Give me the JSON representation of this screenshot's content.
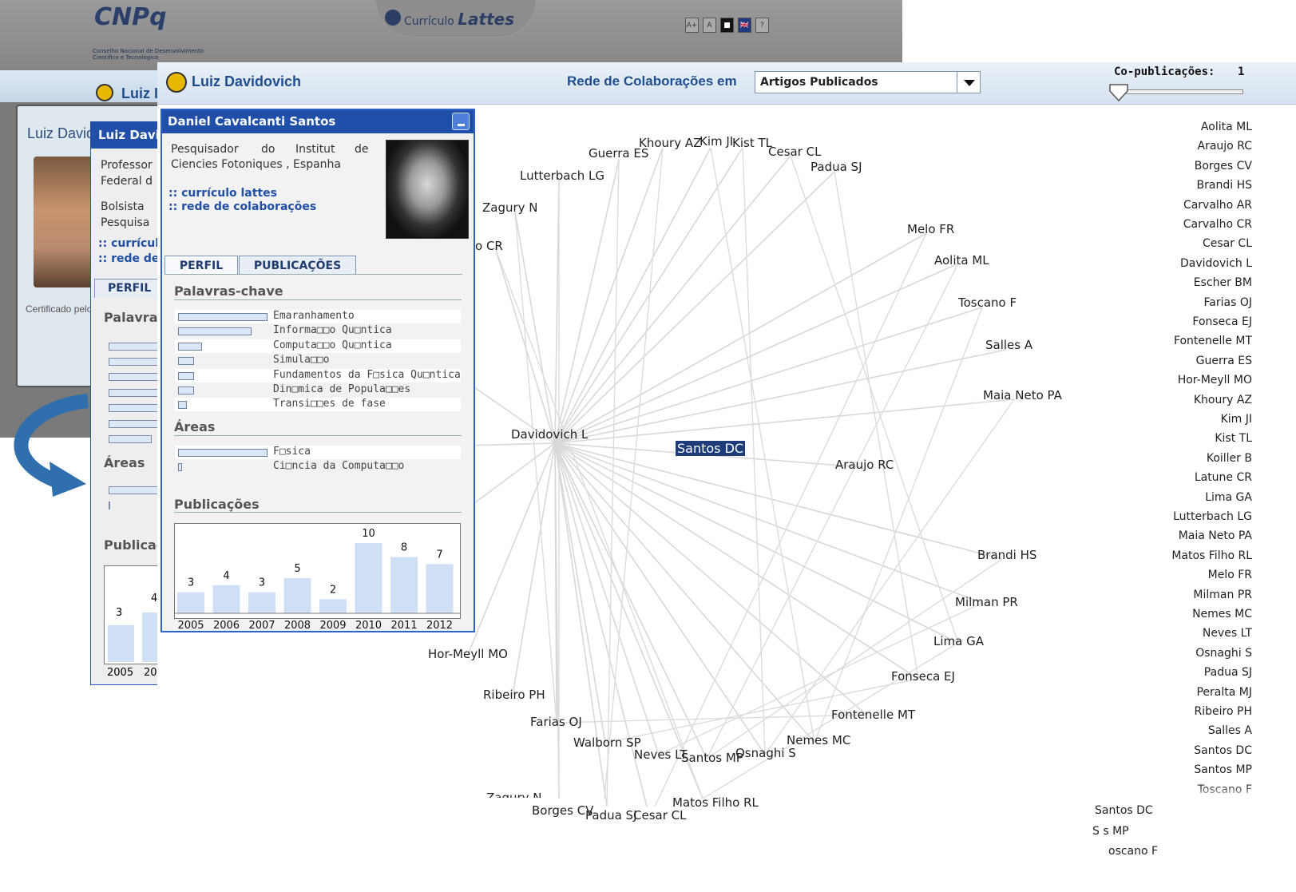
{
  "back_window": {
    "logo": "CNPq",
    "logo_sub_1": "Conselho Nacional de Desenvolvimento",
    "logo_sub_2": "Científico e Tecnológico",
    "lattes_prefix": "Currículo",
    "lattes_name": "Lattes",
    "accessibility": [
      "A+",
      "A",
      "■",
      "🇬🇧",
      "?"
    ]
  },
  "page2": {
    "header": "Luiz I",
    "name": "Luiz Davido",
    "certificate": "Certificado pelo"
  },
  "panel3": {
    "header": "Luiz Davic",
    "line1": "Professor",
    "line2": "Federal d",
    "line3": "Bolsista",
    "line4": "Pesquisa",
    "link1": ":: currícul",
    "link2": ":: rede de",
    "tab": "PERFIL",
    "palavras": "Palavras",
    "areas": "Áreas",
    "publicacoes": "Publicaç",
    "chart_labels": [
      "3",
      "4"
    ],
    "years": [
      "2005",
      "200"
    ]
  },
  "toolbar": {
    "title": "Luiz Davidovich",
    "rede_label": "Rede de Colaborações em",
    "select_value": "Artigos Publicados",
    "copub_label": "Co-publicações:",
    "copub_value": "1"
  },
  "popup": {
    "title": "Daniel Cavalcanti Santos",
    "desc_line1": [
      "Pesquisador",
      "do",
      "Institut",
      "de"
    ],
    "desc_line2": "Ciencies Fotoniques , Espanha",
    "link_lattes": ":: currículo lattes",
    "link_rede": ":: rede de colaborações",
    "tab_perfil": "PERFIL",
    "tab_pub": "PUBLICAÇÕES",
    "sec_keywords": "Palavras-chave",
    "keywords": [
      {
        "label": "Emaranhamento",
        "value": 1.0
      },
      {
        "label": "Informa□□o Qu□ntica",
        "value": 0.82
      },
      {
        "label": "Computa□□o Qu□ntica",
        "value": 0.25
      },
      {
        "label": "Simula□□o",
        "value": 0.16
      },
      {
        "label": "Fundamentos da F□sica Qu□ntica",
        "value": 0.16
      },
      {
        "label": "Din□mica de Popula□□es",
        "value": 0.16
      },
      {
        "label": "Transi□□es de fase",
        "value": 0.08
      }
    ],
    "sec_areas": "Áreas",
    "areas": [
      {
        "label": "F□sica",
        "value": 1.0
      },
      {
        "label": "Ci□ncia da Computa□□o",
        "value": 0.03
      }
    ],
    "sec_pub": "Publicações"
  },
  "chart_data": {
    "type": "bar",
    "categories": [
      "2005",
      "2006",
      "2007",
      "2008",
      "2009",
      "2010",
      "2011",
      "2012"
    ],
    "values": [
      3,
      4,
      3,
      5,
      2,
      10,
      8,
      7
    ],
    "title": "Publicações",
    "ylim": [
      0,
      10
    ]
  },
  "network": {
    "center": "Davidovich L",
    "selected": "Santos DC",
    "nodes": [
      "Khoury AZ",
      "Kim JI",
      "Kist TL",
      "Cesar CL",
      "Guerra ES",
      "Padua SJ",
      "Lutterbach LG",
      "Zagury N",
      "o CR",
      "Melo FR",
      "Aolita ML",
      "Toscano F",
      "Salles A",
      "Maia Neto PA",
      "Araujo RC",
      "Brandi HS",
      "Milman PR",
      "Lima GA",
      "Fonseca EJ",
      "Fontenelle MT",
      "Nemes MC",
      "Osnaghi S",
      "Santos MP",
      "Neves LT",
      "Walborn SP",
      "Farias OJ",
      "Ribeiro PH",
      "Hor-Meyll MO",
      "Matos Filho RL",
      "Borges CV",
      "Padua SJ",
      "Cesar CL",
      "Zagury N"
    ]
  },
  "author_list": [
    "Aolita ML",
    "Araujo RC",
    "Borges CV",
    "Brandi HS",
    "Carvalho AR",
    "Carvalho CR",
    "Cesar CL",
    "Davidovich L",
    "Escher BM",
    "Farias OJ",
    "Fonseca EJ",
    "Fontenelle MT",
    "Guerra ES",
    "Hor-Meyll MO",
    "Khoury AZ",
    "Kim JI",
    "Kist TL",
    "Koiller B",
    "Latune CR",
    "Lima GA",
    "Lutterbach LG",
    "Maia Neto PA",
    "Matos Filho RL",
    "Melo FR",
    "Milman PR",
    "Nemes MC",
    "Neves LT",
    "Osnaghi S",
    "Padua SJ",
    "Peralta MJ",
    "Ribeiro PH",
    "Salles A",
    "Santos DC",
    "Santos MP",
    "Toscano F"
  ],
  "list_overflow": [
    "Santos DC",
    "S   s MP",
    "oscano F"
  ]
}
